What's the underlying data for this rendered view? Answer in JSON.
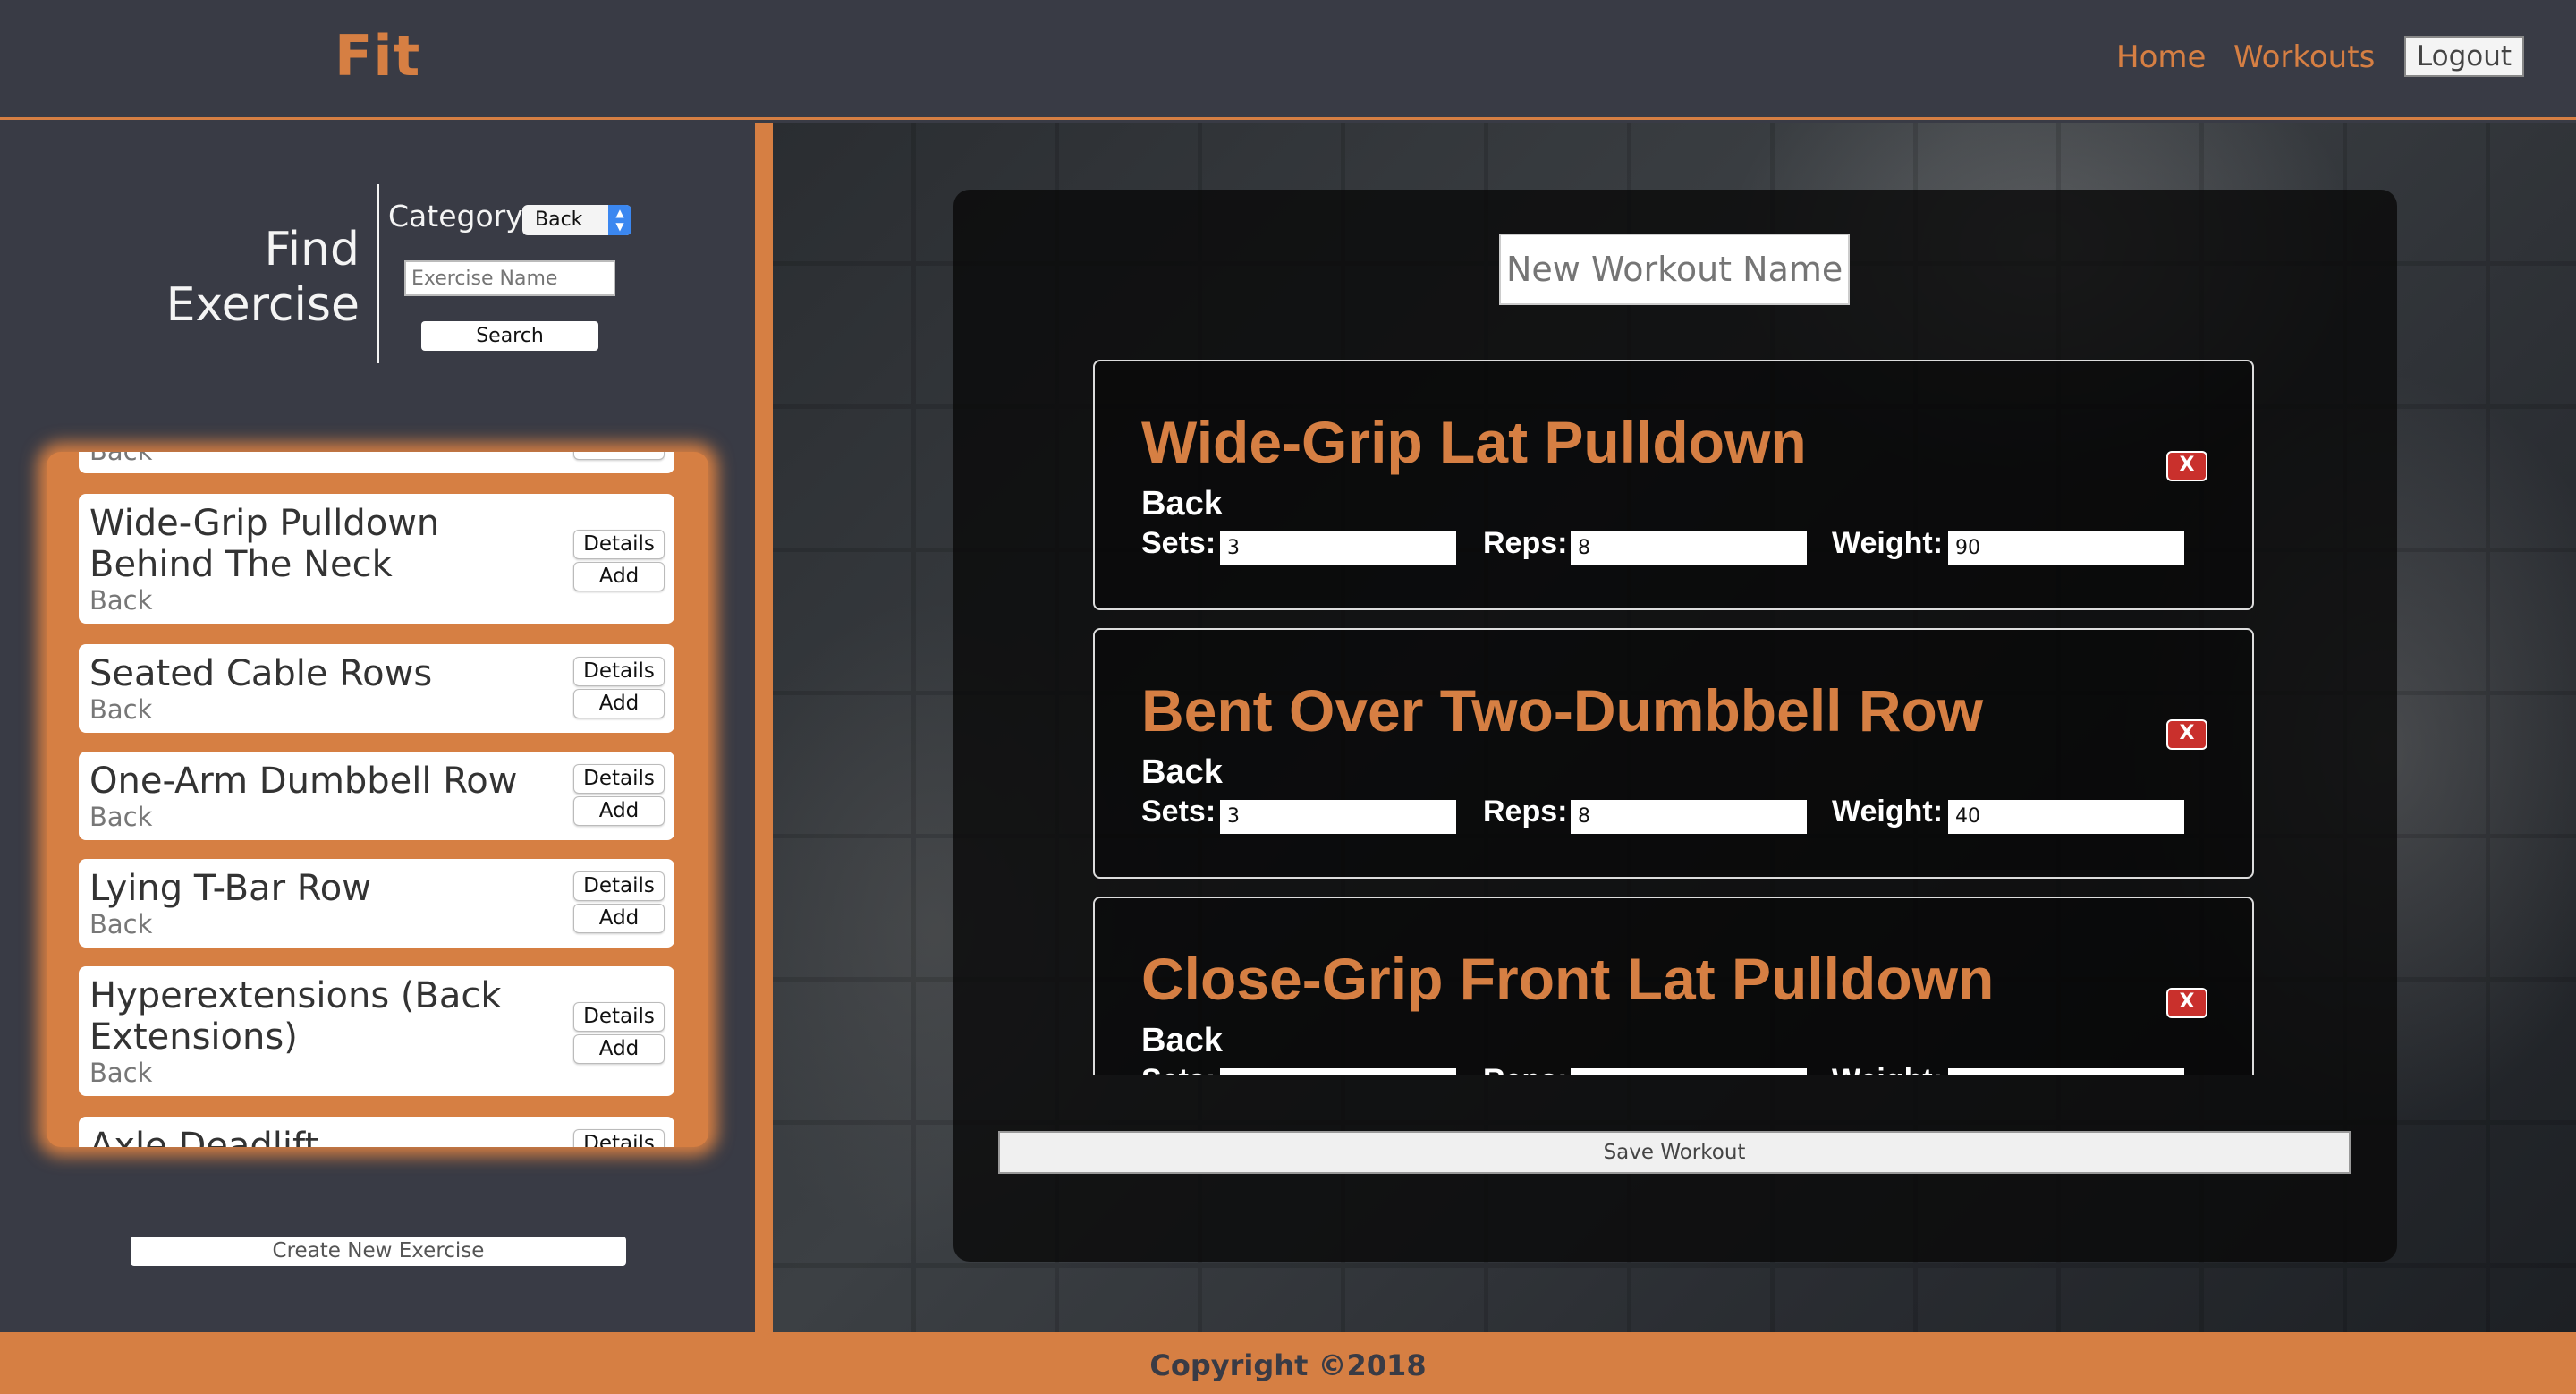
{
  "app": {
    "logo": "Fit"
  },
  "nav": {
    "home": "Home",
    "workouts": "Workouts",
    "logout": "Logout"
  },
  "finder": {
    "title": "Find Exercise",
    "category_label": "Category",
    "category_value": "Back",
    "name_placeholder": "Exercise Name",
    "search_label": "Search"
  },
  "exercise_list": [
    {
      "name": "",
      "category": "Back",
      "add": "Add"
    },
    {
      "name": "Wide-Grip Pulldown Behind The Neck",
      "category": "Back",
      "details": "Details",
      "add": "Add"
    },
    {
      "name": "Seated Cable Rows",
      "category": "Back",
      "details": "Details",
      "add": "Add"
    },
    {
      "name": "One-Arm Dumbbell Row",
      "category": "Back",
      "details": "Details",
      "add": "Add"
    },
    {
      "name": "Lying T-Bar Row",
      "category": "Back",
      "details": "Details",
      "add": "Add"
    },
    {
      "name": "Hyperextensions (Back Extensions)",
      "category": "Back",
      "details": "Details",
      "add": "Add"
    },
    {
      "name": "Axle Deadlift",
      "details": "Details"
    }
  ],
  "create_exercise_label": "Create New Exercise",
  "workout": {
    "name_placeholder": "New Workout Name",
    "labels": {
      "sets": "Sets:",
      "reps": "Reps:",
      "weight": "Weight:",
      "delete": "X"
    },
    "exercises": [
      {
        "name": "Wide-Grip Lat Pulldown",
        "category": "Back",
        "sets": "3",
        "reps": "8",
        "weight": "90"
      },
      {
        "name": "Bent Over Two-Dumbbell Row",
        "category": "Back",
        "sets": "3",
        "reps": "8",
        "weight": "40"
      },
      {
        "name": "Close-Grip Front Lat Pulldown",
        "category": "Back",
        "sets": "",
        "reps": "",
        "weight": ""
      }
    ],
    "save_label": "Save Workout"
  },
  "footer": {
    "copyright": "Copyright ©2018"
  },
  "colors": {
    "accent": "#d67f43",
    "background": "#393b45",
    "delete": "#c9302c"
  }
}
